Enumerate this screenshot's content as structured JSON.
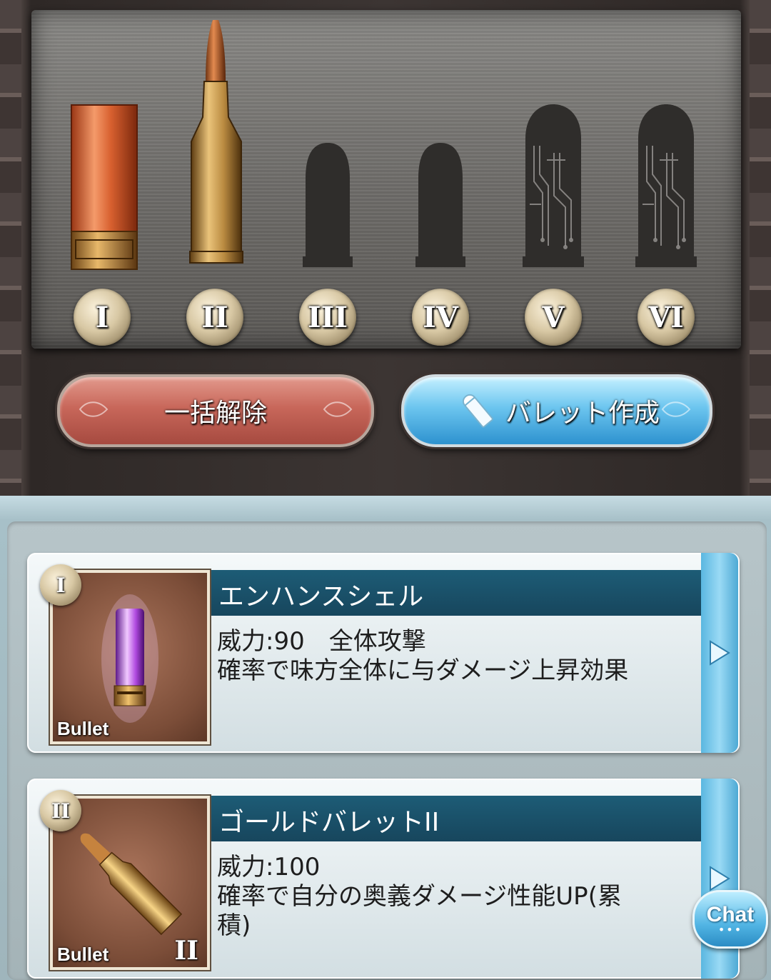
{
  "rack": {
    "slots": [
      {
        "numeral": "I",
        "state": "equipped-shell"
      },
      {
        "numeral": "II",
        "state": "equipped-rifle"
      },
      {
        "numeral": "III",
        "state": "empty"
      },
      {
        "numeral": "IV",
        "state": "empty"
      },
      {
        "numeral": "V",
        "state": "locked"
      },
      {
        "numeral": "VI",
        "state": "locked"
      }
    ]
  },
  "buttons": {
    "release_all": "一括解除",
    "create_bullet": "バレット作成"
  },
  "cards": [
    {
      "badge": "I",
      "title": "エンハンスシェル",
      "desc_line1": "威力:90　全体攻撃",
      "desc_line2": "確率で味方全体に与ダメージ上昇効果",
      "desc_line3": "",
      "thumb_label": "Bullet",
      "thumb_numeral": "",
      "icon": "purple-shell-bullet-icon"
    },
    {
      "badge": "II",
      "title": "ゴールドバレットII",
      "desc_line1": "威力:100",
      "desc_line2": "確率で自分の奥義ダメージ性能UP(累",
      "desc_line3": "積)",
      "thumb_label": "Bullet",
      "thumb_numeral": "II",
      "icon": "gold-rifle-bullet-icon"
    }
  ],
  "chat": {
    "label": "Chat",
    "dots": "•••"
  },
  "colors": {
    "release_button": "#c8675a",
    "create_button": "#6cc5ef",
    "title_bar": "#1d5c76"
  }
}
